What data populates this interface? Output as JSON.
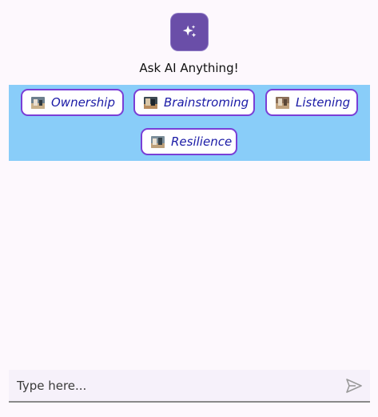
{
  "header": {
    "icon": "sparkles-icon",
    "title": "Ask AI Anything!"
  },
  "prompts": [
    {
      "label": "Ownership",
      "icon": "photo-thumbnail-icon"
    },
    {
      "label": "Brainstroming",
      "icon": "photo-thumbnail-icon"
    },
    {
      "label": "Listening",
      "icon": "photo-thumbnail-icon"
    },
    {
      "label": "Resilience",
      "icon": "photo-thumbnail-icon"
    }
  ],
  "composer": {
    "placeholder": "Type here...",
    "send_icon": "send-icon"
  },
  "colors": {
    "accent": "#6a4ea8",
    "chip_border": "#7a3fd6",
    "chip_area_bg": "#89cdf9",
    "chip_text": "#1a1aa6"
  }
}
